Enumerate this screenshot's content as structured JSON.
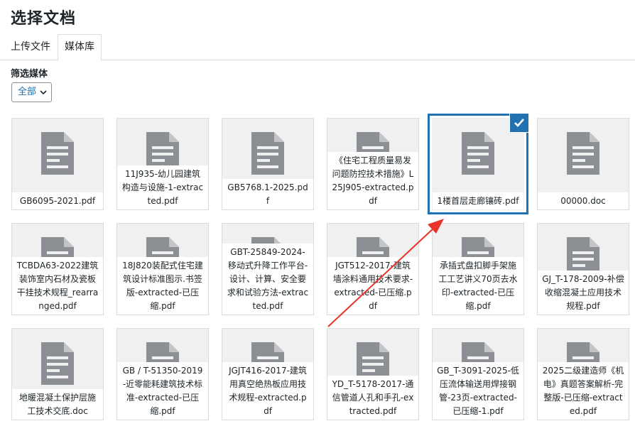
{
  "page": {
    "title": "选择文档"
  },
  "tabs": [
    {
      "label": "上传文件"
    },
    {
      "label": "媒体库"
    }
  ],
  "filter": {
    "label": "筛选媒体",
    "selected": "全部"
  },
  "media_items": [
    {
      "name": "GB6095-2021.pdf",
      "icon": "document-icon"
    },
    {
      "name": "11J935-幼儿园建筑构造与设施-1-extracted.pdf",
      "icon": "document-icon"
    },
    {
      "name": "GB5768.1-2025.pdf",
      "icon": "document-icon"
    },
    {
      "name": "《住宅工程质量易发问题防控技术措施》L25J905-extracted.pdf",
      "icon": "document-icon"
    },
    {
      "name": "1楼首层走廊镶砖.pdf",
      "icon": "document-icon",
      "selected": true
    },
    {
      "name": "00000.doc",
      "icon": "document-icon"
    },
    {
      "name": "TCBDA63-2022建筑装饰室内石材及瓷板干挂技术规程_rearranged.pdf",
      "icon": "document-icon"
    },
    {
      "name": "18J820装配式住宅建筑设计标准图示.书签版-extracted-已压缩.pdf",
      "icon": "document-icon"
    },
    {
      "name": "GBT-25849-2024-移动式升降工作平台-设计、计算、安全要求和试验方法-extracted.pdf",
      "icon": "document-icon"
    },
    {
      "name": "JGT512-2017-建筑墙涂料通用技术要求-extracted-已压缩.pdf",
      "icon": "document-icon"
    },
    {
      "name": "承插式盘扣脚手架施工工艺讲义70页去水印-extracted-已压缩.pdf",
      "icon": "document-icon"
    },
    {
      "name": "GJ_T-178-2009-补偿收缩混凝土应用技术规程.pdf",
      "icon": "document-icon"
    },
    {
      "name": "地暖混凝土保护层施工技术交底.doc",
      "icon": "document-icon"
    },
    {
      "name": "GB / T-51350-2019-近零能耗建筑技术标准-extracted-已压缩.pdf",
      "icon": "document-icon"
    },
    {
      "name": "JGJT416-2017-建筑用真空绝热板应用技术规程-extracted.pdf",
      "icon": "document-icon"
    },
    {
      "name": "YD_T-5178-2017-通信管道人孔和手孔-extracted.pdf",
      "icon": "document-icon"
    },
    {
      "name": "GB_T-3091-2025-低压流体输送用焊接钢管-23页-extracted-已压缩-1.pdf",
      "icon": "document-icon"
    },
    {
      "name": "2025二级建造师《机电》真题答案解析-完整版-已压缩-extracted.pdf",
      "icon": "document-icon"
    }
  ],
  "colors": {
    "accent": "#2271b1",
    "annotation_arrow": "#e8332a"
  }
}
